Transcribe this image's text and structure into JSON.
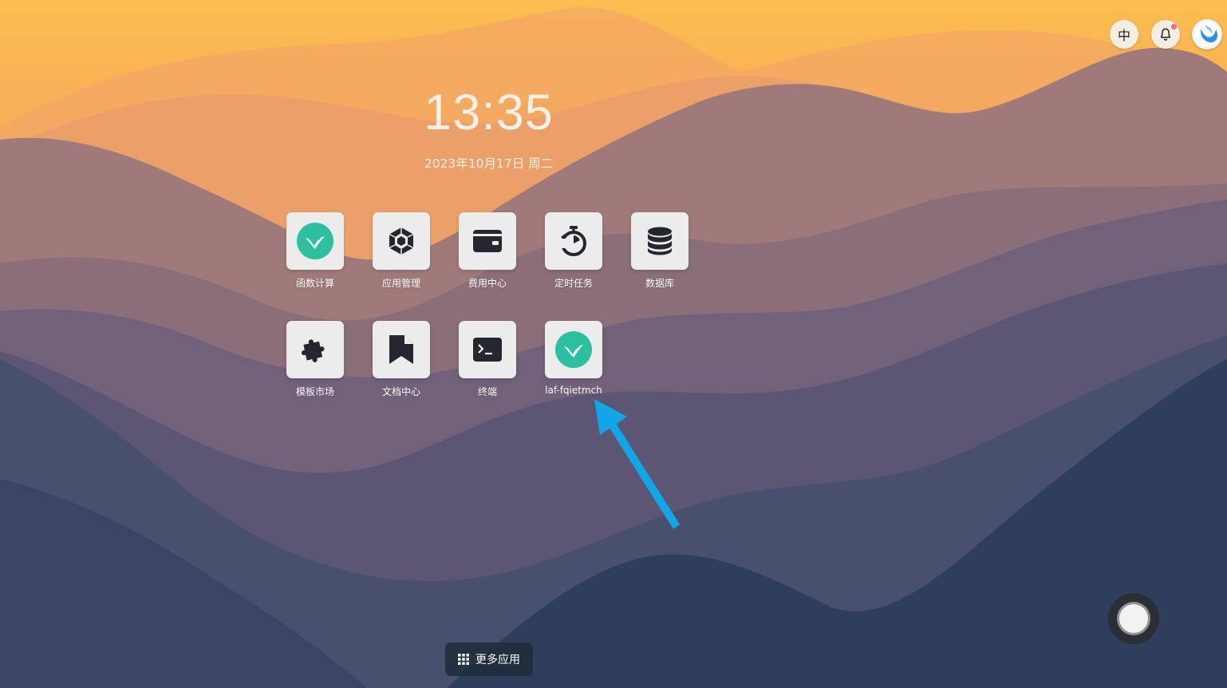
{
  "header": {
    "lang_label": "中",
    "notification_icon": "bell-icon",
    "avatar_icon": "user-avatar-logo"
  },
  "clock": {
    "time": "13:35",
    "date": "2023年10月17日 周二"
  },
  "apps": [
    {
      "label": "函数计算",
      "icon": "laf-logo-icon"
    },
    {
      "label": "应用管理",
      "icon": "app-manage-icon"
    },
    {
      "label": "费用中心",
      "icon": "wallet-icon"
    },
    {
      "label": "定时任务",
      "icon": "timer-icon"
    },
    {
      "label": "数据库",
      "icon": "database-icon"
    },
    {
      "label": "模板市场",
      "icon": "puzzle-icon"
    },
    {
      "label": "文档中心",
      "icon": "bookmark-doc-icon"
    },
    {
      "label": "终端",
      "icon": "terminal-icon"
    },
    {
      "label": "laf-fqietmch",
      "icon": "laf-logo-icon"
    }
  ],
  "dock": {
    "more_apps_label": "更多应用",
    "more_apps_icon": "grid-icon"
  },
  "colors": {
    "annotation_arrow": "#12a5e8",
    "laf_teal": "#2dbfa0",
    "icon_dark": "#24282e",
    "notification_dot": "#ef6a8a"
  }
}
